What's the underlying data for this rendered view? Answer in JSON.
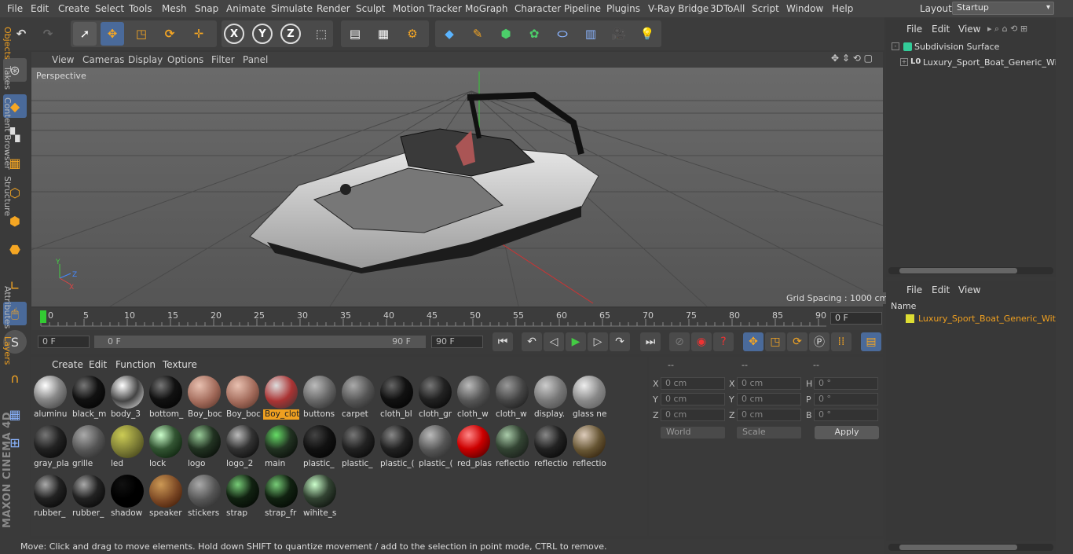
{
  "menu": [
    "File",
    "Edit",
    "Create",
    "Select",
    "Tools",
    "Mesh",
    "Snap",
    "Animate",
    "Simulate",
    "Render",
    "Sculpt",
    "Motion Tracker",
    "MoGraph",
    "Character",
    "Pipeline",
    "Plugins",
    "V-Ray Bridge",
    "3DToAll",
    "Script",
    "Window",
    "Help"
  ],
  "layout": {
    "label": "Layout:",
    "value": "Startup"
  },
  "viewport_menu": [
    "View",
    "Cameras",
    "Display",
    "Options",
    "Filter",
    "Panel"
  ],
  "viewport": {
    "label": "Perspective",
    "grid_spacing": "Grid Spacing : 1000 cm"
  },
  "timeline": {
    "ticks": [
      "0",
      "5",
      "10",
      "15",
      "20",
      "25",
      "30",
      "35",
      "40",
      "45",
      "50",
      "55",
      "60",
      "65",
      "70",
      "75",
      "80",
      "85",
      "90"
    ],
    "frame_field": "0 F"
  },
  "playbar": {
    "start": "0 F",
    "range_start": "0 F",
    "range_end": "90 F",
    "end": "90 F"
  },
  "material_menu": [
    "Create",
    "Edit",
    "Function",
    "Texture"
  ],
  "materials": [
    "aluminu",
    "black_m",
    "body_3",
    "bottom_",
    "Boy_boc",
    "Boy_boc",
    "Boy_clot",
    "buttons",
    "carpet",
    "cloth_bl",
    "cloth_gr",
    "cloth_w",
    "cloth_w",
    "display.",
    "glass ne",
    "gray_pla",
    "grille",
    "led",
    "lock",
    "logo",
    "logo_2",
    "main",
    "plastic_",
    "plastic_",
    "plastic_(",
    "plastic_(",
    "red_plas",
    "reflectio",
    "reflectio",
    "reflectio",
    "rubber_",
    "rubber_",
    "shadow",
    "speaker",
    "stickers",
    "strap",
    "strap_fr",
    "wihite_s"
  ],
  "attributes": {
    "headers": [
      "--",
      "--",
      "--"
    ],
    "rows": [
      {
        "a": "X",
        "av": "0 cm",
        "b": "X",
        "bv": "0 cm",
        "c": "H",
        "cv": "0 °"
      },
      {
        "a": "Y",
        "av": "0 cm",
        "b": "Y",
        "bv": "0 cm",
        "c": "P",
        "cv": "0 °"
      },
      {
        "a": "Z",
        "av": "0 cm",
        "b": "Z",
        "bv": "0 cm",
        "c": "B",
        "cv": "0 °"
      }
    ],
    "coord_mode": "World",
    "size_mode": "Scale",
    "apply": "Apply"
  },
  "objects": {
    "menu": [
      "File",
      "Edit",
      "View"
    ],
    "items": [
      "Subdivision Surface",
      "Luxury_Sport_Boat_Generic_With"
    ]
  },
  "layers": {
    "menu": [
      "File",
      "Edit",
      "View"
    ],
    "column": "Name",
    "items": [
      "Luxury_Sport_Boat_Generic_With_"
    ]
  },
  "right_tabs": [
    "Objects",
    "Takes",
    "Content Browser",
    "Structure",
    "Attributes",
    "Layers"
  ],
  "status": "Move: Click and drag to move elements. Hold down SHIFT to quantize movement / add to the selection in point mode, CTRL to remove.",
  "brand": "MAXON CINEMA 4D"
}
